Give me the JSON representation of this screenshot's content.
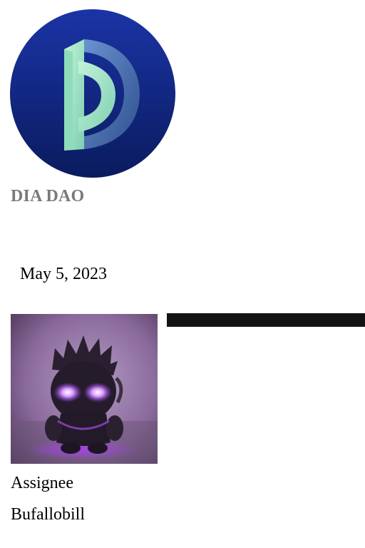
{
  "org": {
    "name": "DIA DAO",
    "logo_icon": "dia-logo-icon",
    "logo_colors": {
      "circle_top": "#1b34a6",
      "circle_bottom": "#0a1b5e",
      "letter_face": "#a9e9c8",
      "letter_side": "#4d79b8"
    }
  },
  "proposal": {
    "date": "May 5, 2023",
    "assignee_label": "Assignee",
    "assignee_name": "Bufallobill",
    "avatar_icon": "assignee-avatar-image"
  }
}
